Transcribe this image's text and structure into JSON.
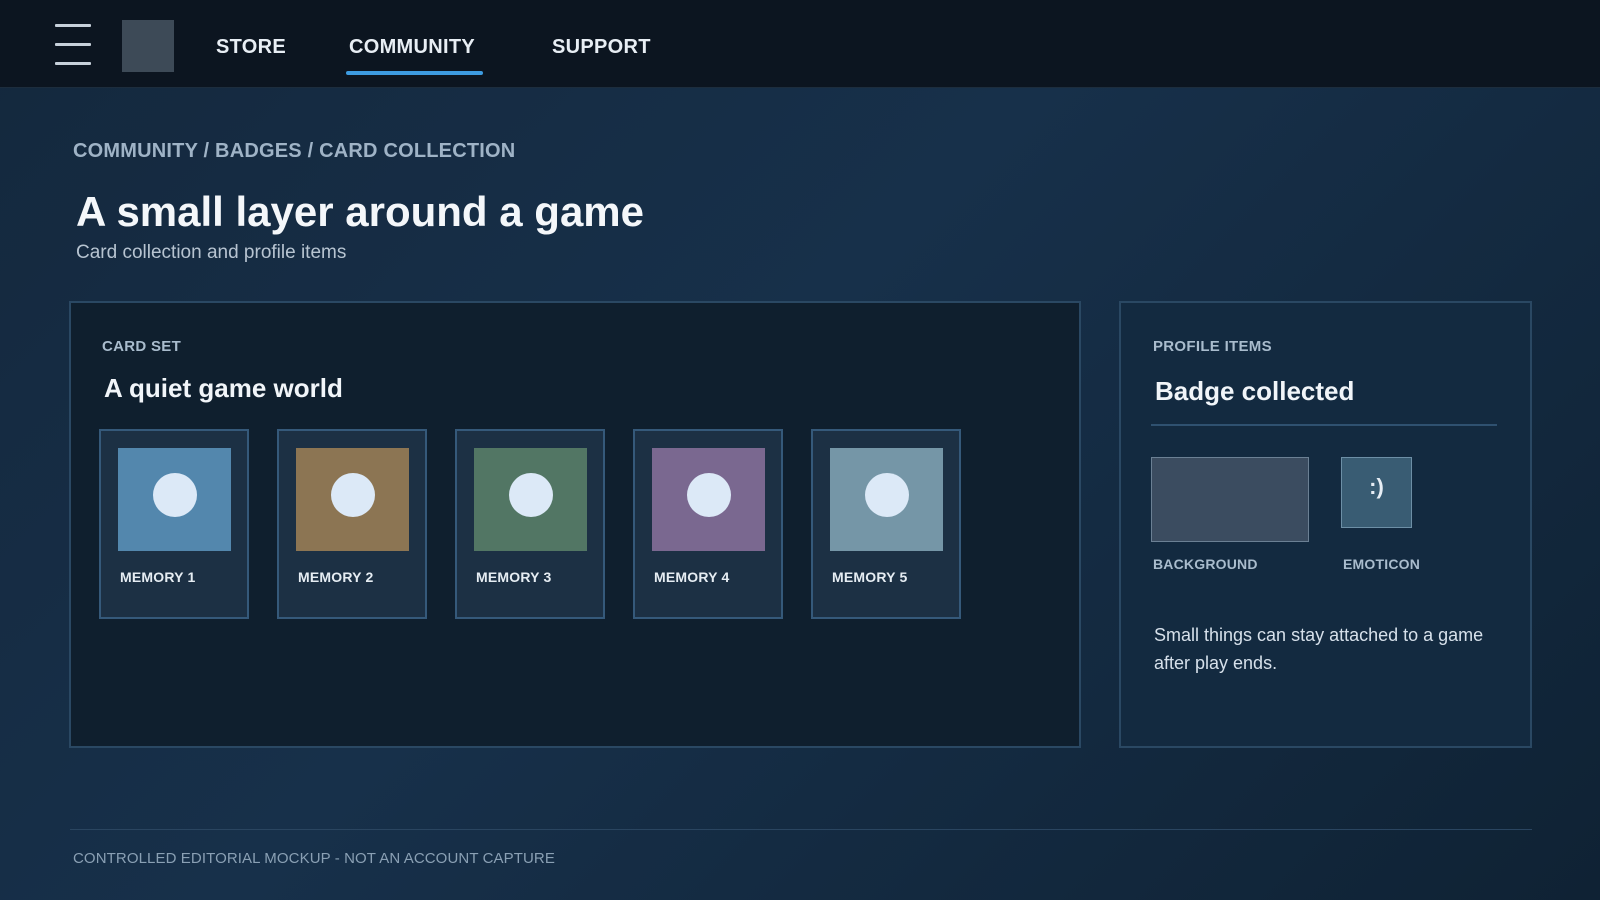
{
  "topbar": {
    "nav": [
      {
        "label": "STORE"
      },
      {
        "label": "COMMUNITY",
        "active": true
      },
      {
        "label": "SUPPORT"
      }
    ],
    "accent_color": "#3d9be0"
  },
  "breadcrumb": [
    "COMMUNITY",
    "BADGES",
    "CARD COLLECTION"
  ],
  "page": {
    "title": "A small layer around a game",
    "subtitle": "Card collection and profile items"
  },
  "card_set": {
    "label": "CARD SET",
    "title": "A quiet game world",
    "cards": [
      {
        "name": "MEMORY 1",
        "color": "#5387ad"
      },
      {
        "name": "MEMORY 2",
        "color": "#8c7553"
      },
      {
        "name": "MEMORY 3",
        "color": "#527664"
      },
      {
        "name": "MEMORY 4",
        "color": "#7a6890"
      },
      {
        "name": "MEMORY 5",
        "color": "#7596a7"
      }
    ]
  },
  "profile_items": {
    "label": "PROFILE ITEMS",
    "title": "Badge collected",
    "background_caption": "BACKGROUND",
    "emoticon_caption": "EMOTICON",
    "emoticon_glyph": ":)",
    "description": "Small things can stay attached to a game after play ends."
  },
  "footer": {
    "text": "CONTROLLED EDITORIAL MOCKUP - NOT AN ACCOUNT CAPTURE"
  }
}
